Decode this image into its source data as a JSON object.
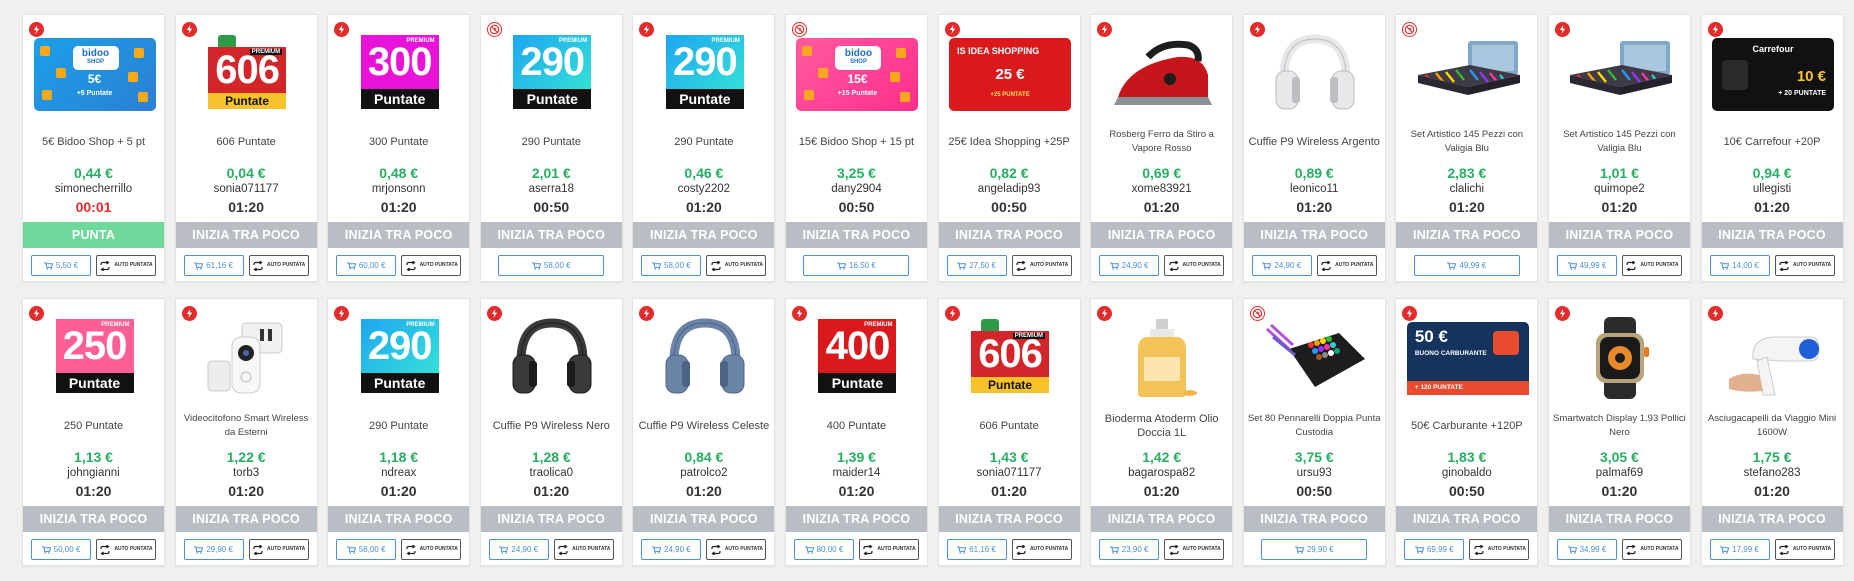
{
  "colors": {
    "green_price": "#27ae60",
    "status_grey": "#b9bec4",
    "status_green": "#6ed89a",
    "badge_red": "#e32b2b",
    "button_blue": "#4a8fd8"
  },
  "auto_label": "AUTO PUNTATA",
  "cards": [
    {
      "badge": "bolt",
      "img": "gift-blue",
      "img_text": {
        "logo": "bidoo",
        "logo_sub": "SHOP",
        "amount": "5€",
        "sub": "+5 Puntate"
      },
      "title": "5€ Bidoo Shop + 5 pt",
      "price": "0,44 €",
      "user": "simonecherrillo",
      "timer": "00:01",
      "timer_red": true,
      "status": "PUNTA",
      "status_green": true,
      "buy": "5,50 €",
      "auto": true
    },
    {
      "badge": "bolt",
      "img": "pkg-xmas",
      "img_text": {
        "number": "606",
        "label": "Puntate",
        "premium": "PREMIUM"
      },
      "title": "606 Puntate",
      "price": "0,04 €",
      "user": "sonia071177",
      "timer": "01:20",
      "status": "INIZIA TRA POCO",
      "buy": "61,16 €",
      "auto": true
    },
    {
      "badge": "bolt",
      "img": "pkg-magenta",
      "img_text": {
        "number": "300",
        "label": "Puntate",
        "premium": "PREMIUM"
      },
      "title": "300 Puntate",
      "price": "0,48 €",
      "user": "mrjonsonn",
      "timer": "01:20",
      "status": "INIZIA TRA POCO",
      "buy": "60,00 €",
      "auto": true
    },
    {
      "badge": "nobid",
      "img": "pkg-cyan",
      "img_text": {
        "number": "290",
        "label": "Puntate",
        "premium": "PREMIUM"
      },
      "title": "290 Puntate",
      "price": "2,01 €",
      "user": "aserra18",
      "timer": "00:50",
      "status": "INIZIA TRA POCO",
      "buy": "58,00 €",
      "auto": false
    },
    {
      "badge": "bolt",
      "img": "pkg-cyan",
      "img_text": {
        "number": "290",
        "label": "Puntate",
        "premium": "PREMIUM"
      },
      "title": "290 Puntate",
      "price": "0,46 €",
      "user": "costy2202",
      "timer": "01:20",
      "status": "INIZIA TRA POCO",
      "buy": "58,00 €",
      "auto": true
    },
    {
      "badge": "nobid",
      "img": "gift-pink",
      "img_text": {
        "logo": "bidoo",
        "logo_sub": "SHOP",
        "amount": "15€",
        "sub": "+15 Puntate"
      },
      "title": "15€ Bidoo Shop + 15 pt",
      "price": "3,25 €",
      "user": "dany2904",
      "timer": "00:50",
      "status": "INIZIA TRA POCO",
      "buy": "16,50 €",
      "auto": false
    },
    {
      "badge": "bolt",
      "img": "idea",
      "img_text": {
        "brand": "IS IDEA SHOPPING",
        "amount": "25 €",
        "sub": "+25 PUNTATE"
      },
      "title": "25€ Idea Shopping +25P",
      "price": "0,82 €",
      "user": "angeladip93",
      "timer": "00:50",
      "status": "INIZIA TRA POCO",
      "buy": "27,50 €",
      "auto": true
    },
    {
      "badge": "bolt",
      "img": "iron",
      "title": "Rosberg Ferro da Stiro a Vapore Rosso",
      "small": true,
      "price": "0,69 €",
      "user": "xome83921",
      "timer": "01:20",
      "status": "INIZIA TRA POCO",
      "buy": "24,90 €",
      "auto": true
    },
    {
      "badge": "bolt",
      "img": "headphones-white",
      "title": "Cuffie P9 Wireless Argento",
      "price": "0,89 €",
      "user": "leonico11",
      "timer": "01:20",
      "status": "INIZIA TRA POCO",
      "buy": "24,90 €",
      "auto": true
    },
    {
      "badge": "nobid",
      "img": "art-set",
      "title": "Set Artistico 145 Pezzi con Valigia Blu",
      "small": true,
      "price": "2,83 €",
      "user": "clalichi",
      "timer": "01:20",
      "status": "INIZIA TRA POCO",
      "buy": "49,99 €",
      "auto": false
    },
    {
      "badge": "bolt",
      "img": "art-set",
      "title": "Set Artistico 145 Pezzi con Valigia Blu",
      "small": true,
      "price": "1,01 €",
      "user": "quimope2",
      "timer": "01:20",
      "status": "INIZIA TRA POCO",
      "buy": "49,99 €",
      "auto": true
    },
    {
      "badge": "bolt",
      "img": "carrefour",
      "img_text": {
        "brand": "Carrefour",
        "amount": "10 €",
        "sub": "+ 20 PUNTATE"
      },
      "title": "10€ Carrefour +20P",
      "price": "0,94 €",
      "user": "ullegisti",
      "timer": "01:20",
      "status": "INIZIA TRA POCO",
      "buy": "14,00 €",
      "auto": true
    },
    {
      "badge": "bolt",
      "img": "pkg-pinkp",
      "img_text": {
        "number": "250",
        "label": "Puntate",
        "premium": "PREMIUM"
      },
      "title": "250 Puntate",
      "price": "1,13 €",
      "user": "johngianni",
      "timer": "01:20",
      "status": "INIZIA TRA POCO",
      "buy": "50,00 €",
      "auto": true
    },
    {
      "badge": "bolt",
      "img": "doorbell",
      "title": "Videocitofono Smart Wireless da Esterni",
      "small": true,
      "price": "1,22 €",
      "user": "torb3",
      "timer": "01:20",
      "status": "INIZIA TRA POCO",
      "buy": "29,90 €",
      "auto": true
    },
    {
      "badge": "bolt",
      "img": "pkg-cyan",
      "img_text": {
        "number": "290",
        "label": "Puntate",
        "premium": "PREMIUM"
      },
      "title": "290 Puntate",
      "price": "1,18 €",
      "user": "ndreax",
      "timer": "01:20",
      "status": "INIZIA TRA POCO",
      "buy": "58,00 €",
      "auto": true
    },
    {
      "badge": "bolt",
      "img": "headphones-black",
      "title": "Cuffie P9 Wireless Nero",
      "price": "1,28 €",
      "user": "traolica0",
      "timer": "01:20",
      "status": "INIZIA TRA POCO",
      "buy": "24,90 €",
      "auto": true
    },
    {
      "badge": "bolt",
      "img": "headphones-blue",
      "title": "Cuffie P9 Wireless Celeste",
      "price": "0,84 €",
      "user": "patrolco2",
      "timer": "01:20",
      "status": "INIZIA TRA POCO",
      "buy": "24,90 €",
      "auto": true
    },
    {
      "badge": "bolt",
      "img": "pkg-red",
      "img_text": {
        "number": "400",
        "label": "Puntate",
        "premium": "PREMIUM"
      },
      "title": "400 Puntate",
      "price": "1,39 €",
      "user": "maider14",
      "timer": "01:20",
      "status": "INIZIA TRA POCO",
      "buy": "80,00 €",
      "auto": true
    },
    {
      "badge": "bolt",
      "img": "pkg-xmas",
      "img_text": {
        "number": "606",
        "label": "Puntate",
        "premium": "PREMIUM"
      },
      "title": "606 Puntate",
      "price": "1,43 €",
      "user": "sonia071177",
      "timer": "01:20",
      "status": "INIZIA TRA POCO",
      "buy": "61,16 €",
      "auto": true
    },
    {
      "badge": "bolt",
      "img": "oil",
      "title": "Bioderma Atoderm Olio Doccia 1L",
      "price": "1,42 €",
      "user": "bagarospa82",
      "timer": "01:20",
      "status": "INIZIA TRA POCO",
      "buy": "23,90 €",
      "auto": true
    },
    {
      "badge": "nobid",
      "img": "markers",
      "title": "Set 80 Pennarelli Doppia Punta Custodia",
      "small": true,
      "price": "3,75 €",
      "user": "ursu93",
      "timer": "00:50",
      "status": "INIZIA TRA POCO",
      "buy": "29,90 €",
      "auto": false
    },
    {
      "badge": "bolt",
      "img": "fuel",
      "img_text": {
        "amount": "50 €",
        "line2": "BUONO CARBURANTE",
        "sub": "+ 120 PUNTATE"
      },
      "title": "50€ Carburante +120P",
      "price": "1,83 €",
      "user": "ginobaldo",
      "timer": "00:50",
      "status": "INIZIA TRA POCO",
      "buy": "69,99 €",
      "auto": true
    },
    {
      "badge": "bolt",
      "img": "watch",
      "title": "Smartwatch Display 1.93 Pollici Nero",
      "small": true,
      "price": "3,05 €",
      "user": "palmaf69",
      "timer": "01:20",
      "status": "INIZIA TRA POCO",
      "buy": "34,99 €",
      "auto": true
    },
    {
      "badge": "bolt",
      "img": "hairdryer",
      "title": "Asciugacapelli da Viaggio Mini 1600W",
      "small": true,
      "price": "1,75 €",
      "user": "stefano283",
      "timer": "01:20",
      "status": "INIZIA TRA POCO",
      "buy": "17,99 €",
      "auto": true
    }
  ]
}
